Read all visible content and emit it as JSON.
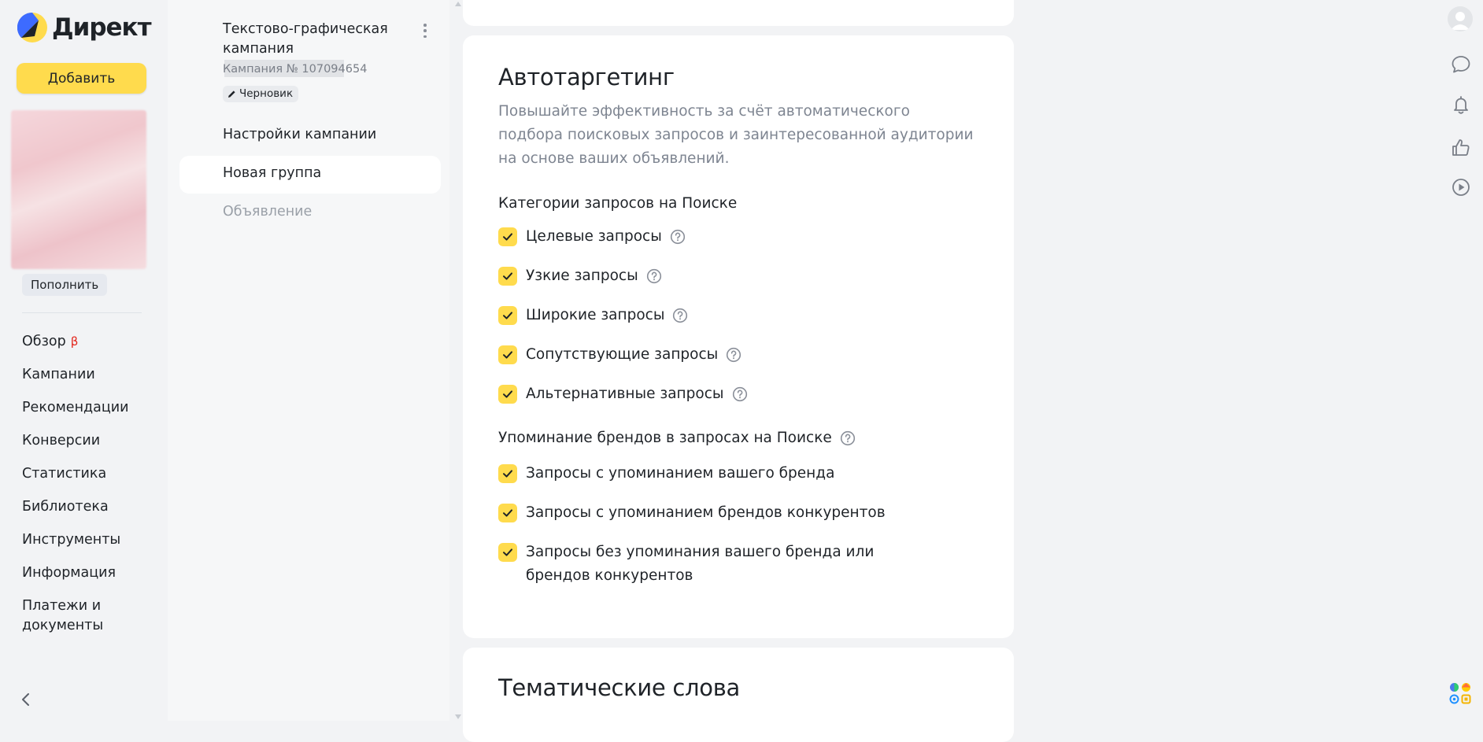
{
  "brand": {
    "name": "Директ"
  },
  "nav": {
    "add_label": "Добавить",
    "topup_label": "Пополнить",
    "items": [
      {
        "label": "Обзор",
        "badge": "β"
      },
      {
        "label": "Кампании"
      },
      {
        "label": "Рекомендации"
      },
      {
        "label": "Конверсии"
      },
      {
        "label": "Статистика"
      },
      {
        "label": "Библиотека"
      },
      {
        "label": "Инструменты"
      },
      {
        "label": "Информация"
      },
      {
        "label": "Платежи и документы"
      }
    ]
  },
  "campaign": {
    "title": "Текстово-графическая кампания",
    "number": "Кампания № 107094654",
    "status": "Черновик",
    "menu": [
      {
        "label": "Настройки кампании"
      },
      {
        "label": "Новая группа"
      },
      {
        "label": "Объявление"
      }
    ]
  },
  "autotargeting": {
    "title": "Автотаргетинг",
    "description": "Повышайте эффективность за счёт автоматического подбора поисковых запросов и заинтересованной аудитории на основе ваших объявлений.",
    "categories_title": "Категории запросов на Поиске",
    "categories": [
      {
        "label": "Целевые запросы",
        "checked": true
      },
      {
        "label": "Узкие запросы",
        "checked": true
      },
      {
        "label": "Широкие запросы",
        "checked": true
      },
      {
        "label": "Сопутствующие запросы",
        "checked": true
      },
      {
        "label": "Альтернативные запросы",
        "checked": true
      }
    ],
    "brands_title": "Упоминание брендов в запросах на Поиске",
    "brands": [
      {
        "label": "Запросы с упоминанием вашего бренда",
        "checked": true
      },
      {
        "label": "Запросы с упоминанием брендов конкурентов",
        "checked": true
      },
      {
        "label": "Запросы без упоминания вашего бренда или брендов конкурентов",
        "checked": true
      }
    ]
  },
  "thematic": {
    "title": "Тематические слова"
  },
  "icons": {
    "rail": [
      "avatar",
      "chat-icon",
      "bell-icon",
      "thumbs-up-icon",
      "play-icon"
    ],
    "apps": "apps-icon"
  },
  "colors": {
    "accent": "#ffdb4d",
    "text": "#1f2328",
    "muted": "#7e8591",
    "background": "#f2f3f5",
    "badge": "#e3241b"
  }
}
